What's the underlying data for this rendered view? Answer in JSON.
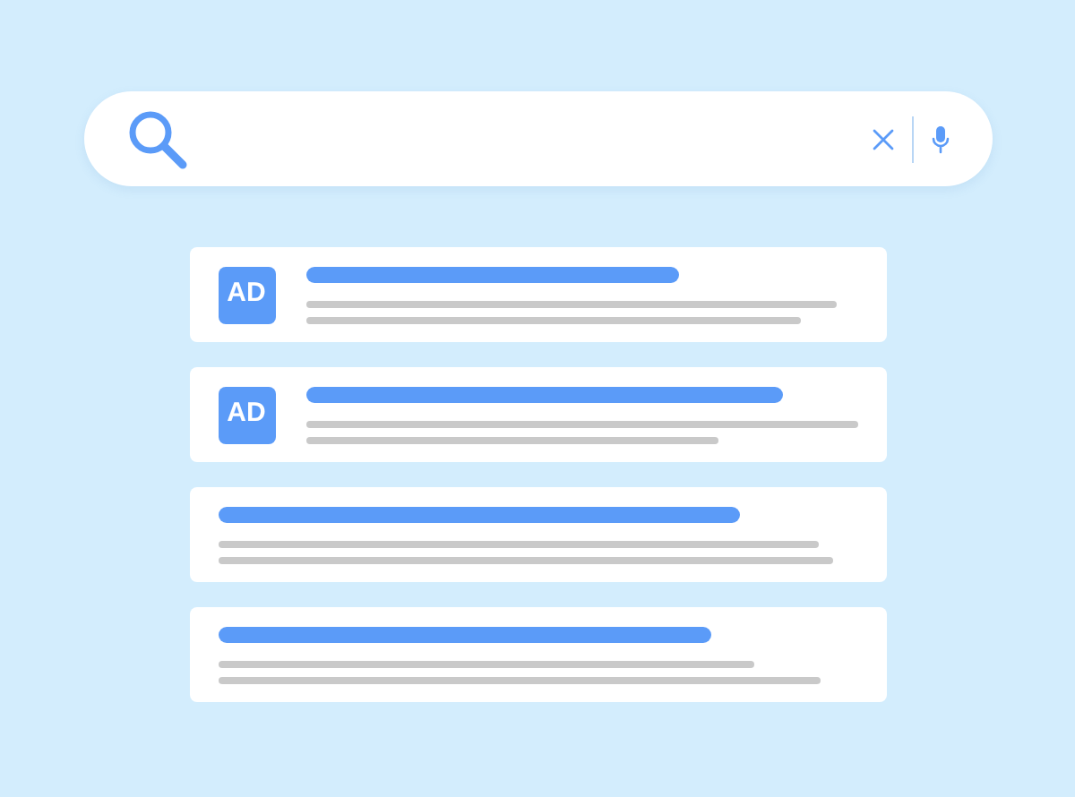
{
  "results": [
    {
      "kind": "ad",
      "badge": "AD"
    },
    {
      "kind": "ad",
      "badge": "AD"
    },
    {
      "kind": "organic"
    },
    {
      "kind": "organic"
    }
  ]
}
